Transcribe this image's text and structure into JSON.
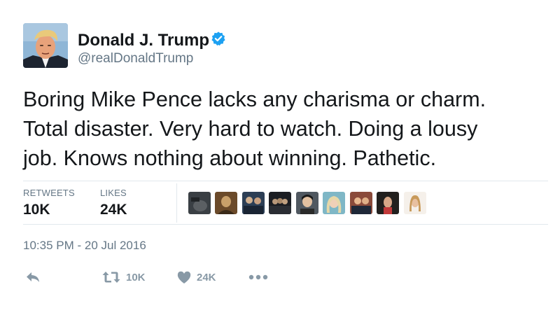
{
  "user": {
    "name": "Donald J. Trump",
    "handle": "@realDonaldTrump",
    "verified_icon": "verified-badge-icon"
  },
  "tweet": {
    "lines": [
      "Boring Mike Pence lacks any charisma or charm.",
      "Total disaster. Very hard to watch. Doing a lousy",
      "job. Knows nothing about winning. Pathetic."
    ]
  },
  "stats": {
    "retweets_label": "RETWEETS",
    "retweets_value": "10K",
    "likes_label": "LIKES",
    "likes_value": "24K",
    "liker_avatar_count": 9
  },
  "timestamp": "10:35 PM - 20 Jul 2016",
  "actions": {
    "reply_icon": "reply-icon",
    "retweet_icon": "retweet-icon",
    "retweet_count": "10K",
    "like_icon": "heart-icon",
    "like_count": "24K",
    "more_icon": "more-dots-icon"
  },
  "colors": {
    "text": "#14171a",
    "secondary": "#657786",
    "action": "#8899a6",
    "verified": "#1da1f2",
    "divider": "#e1e8ed"
  }
}
